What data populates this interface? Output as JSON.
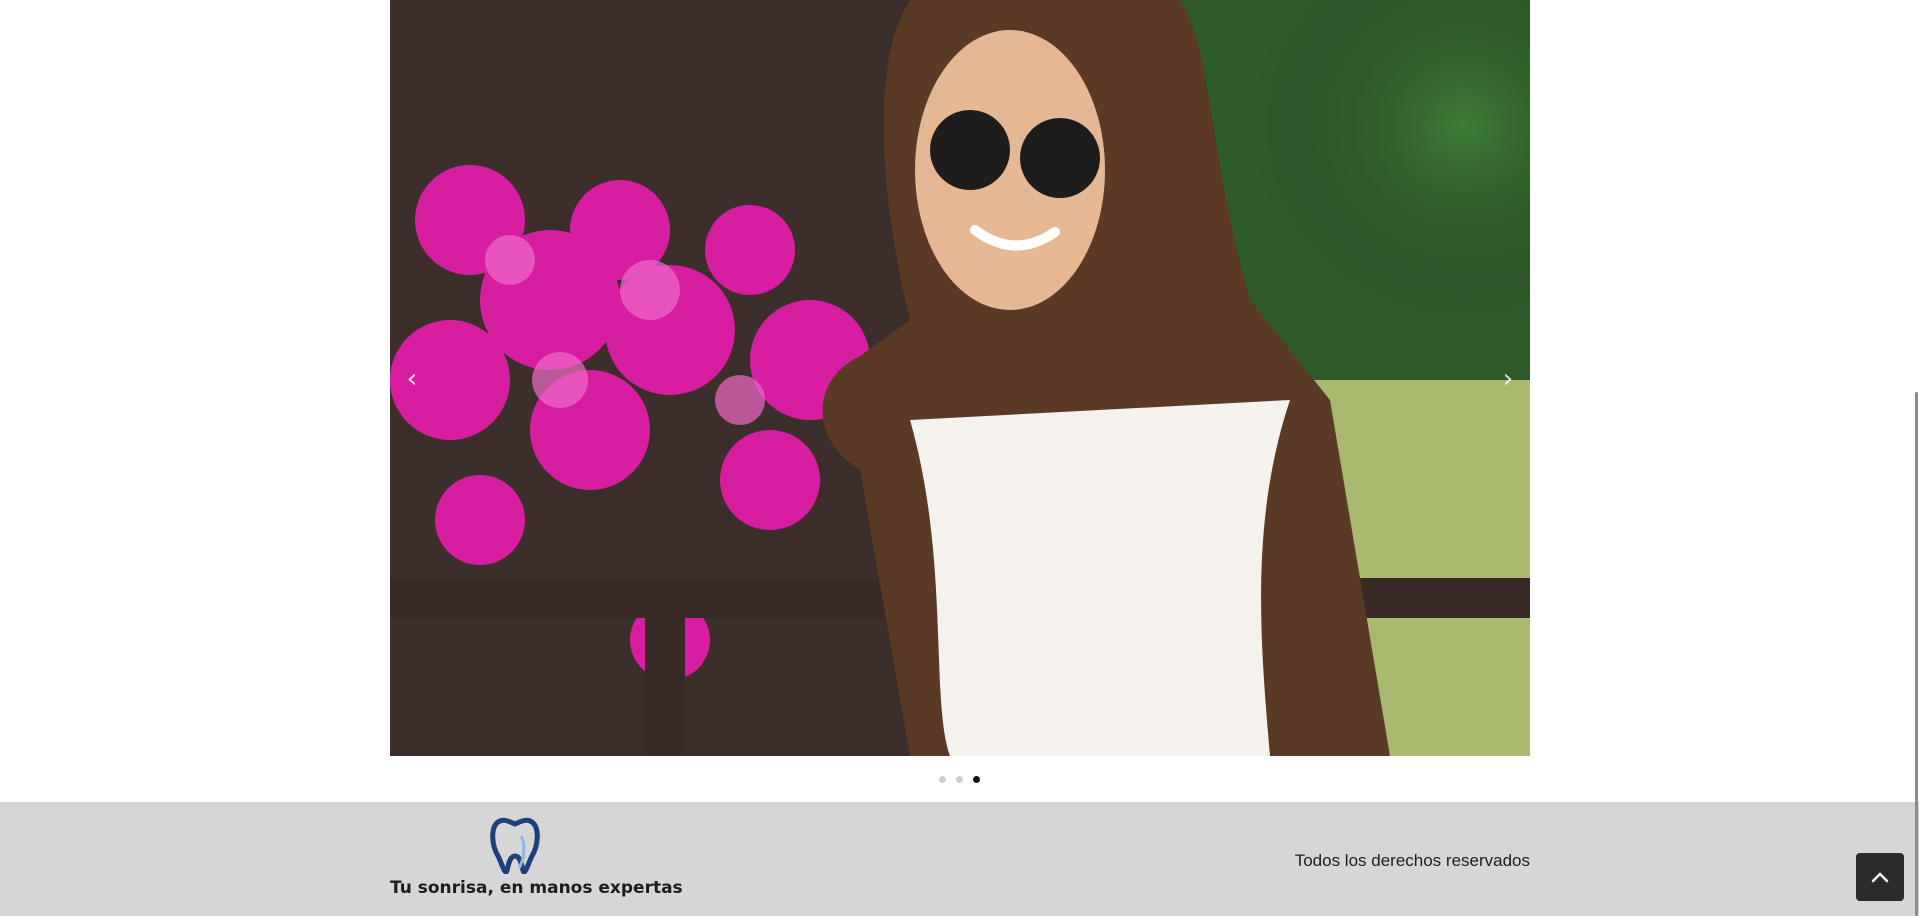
{
  "carousel": {
    "image_alt": "Smiling woman with sunglasses in front of pink bougainvillea flowers",
    "prev_icon": "chevron-left-icon",
    "next_icon": "chevron-right-icon",
    "slide_count": 3,
    "active_slide": 3
  },
  "footer": {
    "logo_icon": "tooth-logo-icon",
    "tagline": "Tu sonrisa, en manos expertas",
    "rights": "Todos los derechos reservados"
  },
  "back_to_top": {
    "icon": "chevron-up-icon"
  },
  "colors": {
    "footer_bg": "#d6d6d6",
    "logo_blue": "#1f3f7a",
    "dot_active": "#111111",
    "dot_inactive": "#cfcfcf",
    "back_top_bg": "#2b2b2b"
  }
}
